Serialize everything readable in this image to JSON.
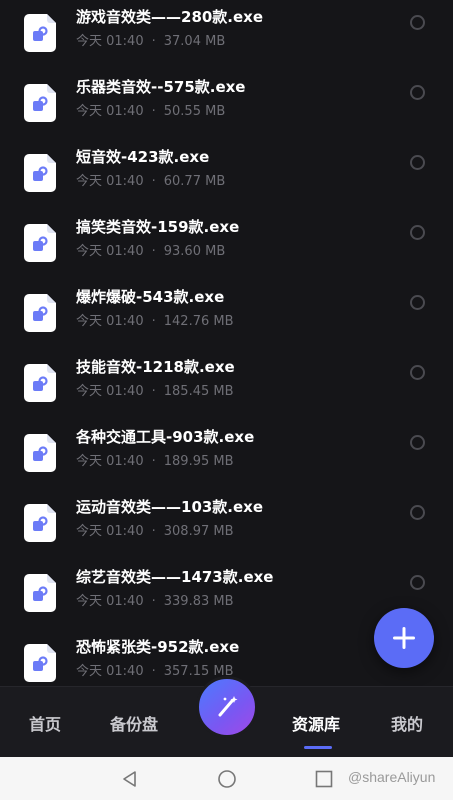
{
  "files": [
    {
      "name": "游戏音效类——280款.exe",
      "date": "今天 01:40",
      "size": "37.04 MB"
    },
    {
      "name": "乐器类音效--575款.exe",
      "date": "今天 01:40",
      "size": "50.55 MB"
    },
    {
      "name": "短音效-423款.exe",
      "date": "今天 01:40",
      "size": "60.77 MB"
    },
    {
      "name": "搞笑类音效-159款.exe",
      "date": "今天 01:40",
      "size": "93.60 MB"
    },
    {
      "name": "爆炸爆破-543款.exe",
      "date": "今天 01:40",
      "size": "142.76 MB"
    },
    {
      "name": "技能音效-1218款.exe",
      "date": "今天 01:40",
      "size": "185.45 MB"
    },
    {
      "name": "各种交通工具-903款.exe",
      "date": "今天 01:40",
      "size": "189.95 MB"
    },
    {
      "name": "运动音效类——103款.exe",
      "date": "今天 01:40",
      "size": "308.97 MB"
    },
    {
      "name": "综艺音效类——1473款.exe",
      "date": "今天 01:40",
      "size": "339.83 MB"
    },
    {
      "name": "恐怖紧张类-952款.exe",
      "date": "今天 01:40",
      "size": "357.15 MB"
    }
  ],
  "meta_separator": "·",
  "nav": {
    "home": "首页",
    "backup": "备份盘",
    "library": "资源库",
    "mine": "我的",
    "active": "library"
  },
  "watermark": "@shareAliyun",
  "icons": {
    "file": "app-file-icon",
    "add": "plus-icon",
    "center": "magic-wand-icon",
    "back": "back-triangle-icon",
    "home": "home-circle-icon",
    "recent": "recent-square-icon"
  },
  "colors": {
    "accent": "#5b6cf6",
    "background": "#151518",
    "nav_background": "#1b1b1f"
  }
}
